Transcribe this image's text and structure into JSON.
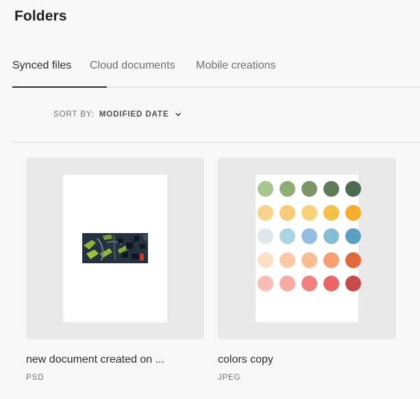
{
  "header": {
    "title": "Folders"
  },
  "tabs": [
    {
      "label": "Synced files",
      "active": true
    },
    {
      "label": "Cloud documents",
      "active": false
    },
    {
      "label": "Mobile creations",
      "active": false
    }
  ],
  "sort": {
    "label": "SORT BY:",
    "value": "MODIFIED DATE"
  },
  "files": [
    {
      "name": "new document created on ...",
      "type": "PSD",
      "thumbnail": "map-preview"
    },
    {
      "name": "colors copy",
      "type": "JPEG",
      "thumbnail": "color-palette"
    }
  ],
  "palette_colors": [
    [
      "#a7c690",
      "#8fae74",
      "#7b9466",
      "#607b57",
      "#4f6b4e"
    ],
    [
      "#f9d28c",
      "#f8cb78",
      "#f8d275",
      "#f6bf45",
      "#f5ad2d"
    ],
    [
      "#dee7ea",
      "#a9d4e0",
      "#95bde3",
      "#86bdd2",
      "#5aa1c1"
    ],
    [
      "#fde0c6",
      "#fbc9a6",
      "#f9bc93",
      "#f79f72",
      "#e3683c"
    ],
    [
      "#f8beb5",
      "#f5aaa3",
      "#f07f7d",
      "#ea6666",
      "#c64c4b"
    ]
  ]
}
